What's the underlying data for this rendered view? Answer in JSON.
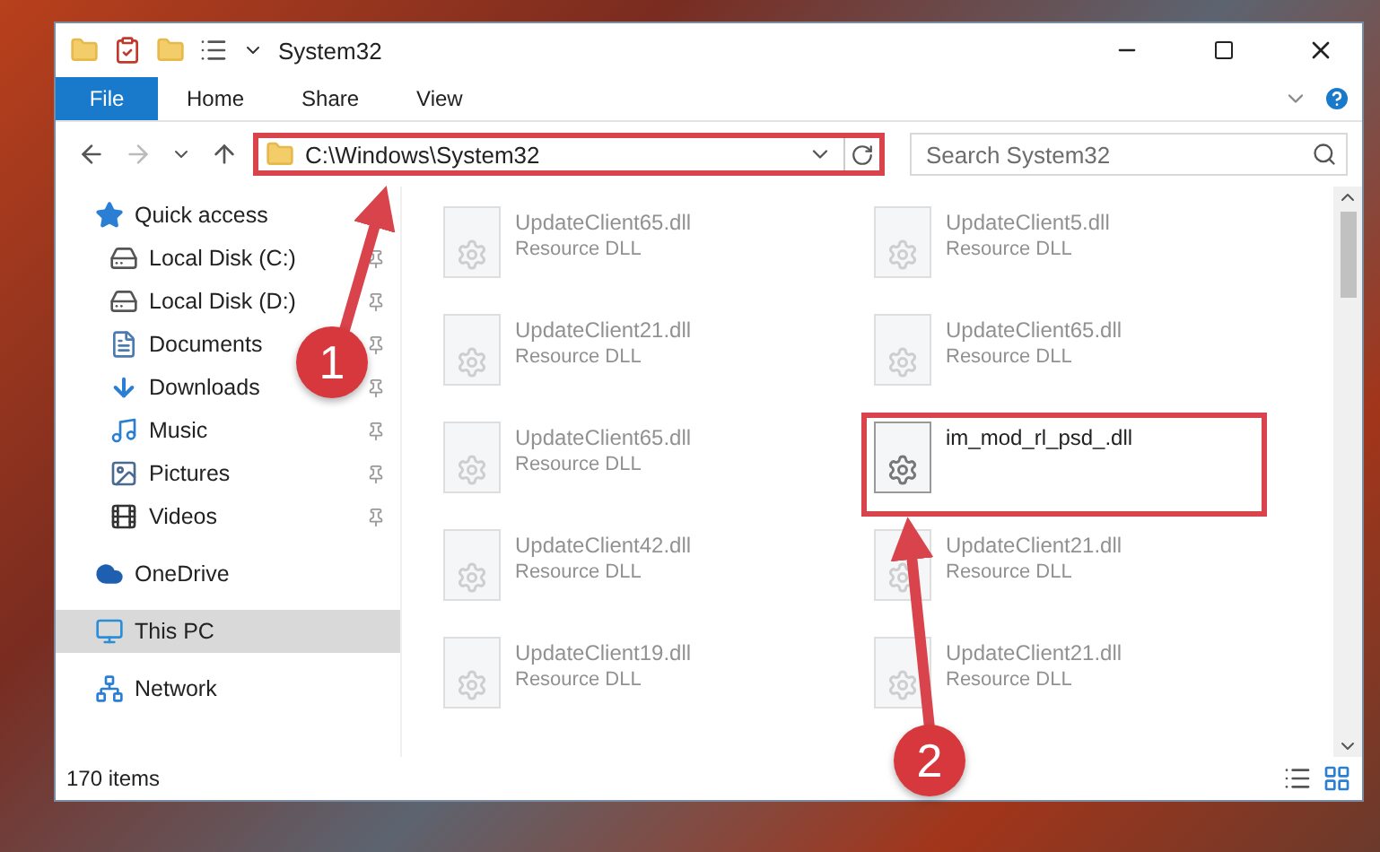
{
  "window": {
    "title": "System32"
  },
  "ribbon_tabs": [
    {
      "label": "File",
      "selected": true
    },
    {
      "label": "Home",
      "selected": false
    },
    {
      "label": "Share",
      "selected": false
    },
    {
      "label": "View",
      "selected": false
    }
  ],
  "address": {
    "path": "C:\\Windows\\System32",
    "marked": true
  },
  "search": {
    "placeholder": "Search System32"
  },
  "sidebar": {
    "items": [
      {
        "label": "Quick access",
        "kind": "quick",
        "selected": false,
        "children": [
          {
            "label": "Local Disk (C:)",
            "kind": "drive",
            "pinned": true,
            "selected": false
          },
          {
            "label": "Local Disk (D:)",
            "kind": "drive",
            "pinned": true,
            "selected": false
          },
          {
            "label": "Documents",
            "kind": "documents",
            "pinned": true,
            "selected": false
          },
          {
            "label": "Downloads",
            "kind": "downloads",
            "pinned": true,
            "selected": false
          },
          {
            "label": "Music",
            "kind": "music",
            "pinned": true,
            "selected": false
          },
          {
            "label": "Pictures",
            "kind": "pictures",
            "pinned": true,
            "selected": false
          },
          {
            "label": "Videos",
            "kind": "videos",
            "pinned": true,
            "selected": false
          }
        ]
      },
      {
        "label": "OneDrive",
        "kind": "cloud",
        "selected": false
      },
      {
        "label": "This PC",
        "kind": "pc",
        "selected": true
      },
      {
        "label": "Network",
        "kind": "network",
        "selected": false
      }
    ]
  },
  "files": [
    {
      "name": "UpdateClient65.dll",
      "type": "Resource DLL",
      "blurred": true,
      "marked": false
    },
    {
      "name": "UpdateClient5.dll",
      "type": "Resource DLL",
      "blurred": true,
      "marked": false
    },
    {
      "name": "UpdateClient21.dll",
      "type": "Resource DLL",
      "blurred": true,
      "marked": false
    },
    {
      "name": "UpdateClient65.dll",
      "type": "Resource DLL",
      "blurred": true,
      "marked": false
    },
    {
      "name": "UpdateClient65.dll",
      "type": "Resource DLL",
      "blurred": true,
      "marked": false
    },
    {
      "name": "im_mod_rl_psd_.dll",
      "blurred": false,
      "marked": true
    },
    {
      "name": "UpdateClient42.dll",
      "type": "Resource DLL",
      "blurred": true,
      "marked": false
    },
    {
      "name": "UpdateClient21.dll",
      "type": "Resource DLL",
      "blurred": true,
      "marked": false
    },
    {
      "name": "UpdateClient19.dll",
      "type": "Resource DLL",
      "blurred": true,
      "marked": false
    },
    {
      "name": "UpdateClient21.dll",
      "type": "Resource DLL",
      "blurred": true,
      "marked": false
    }
  ],
  "status_bar": {
    "count": "170 items"
  },
  "annotations": [
    {
      "number": "1"
    },
    {
      "number": "2"
    }
  ]
}
